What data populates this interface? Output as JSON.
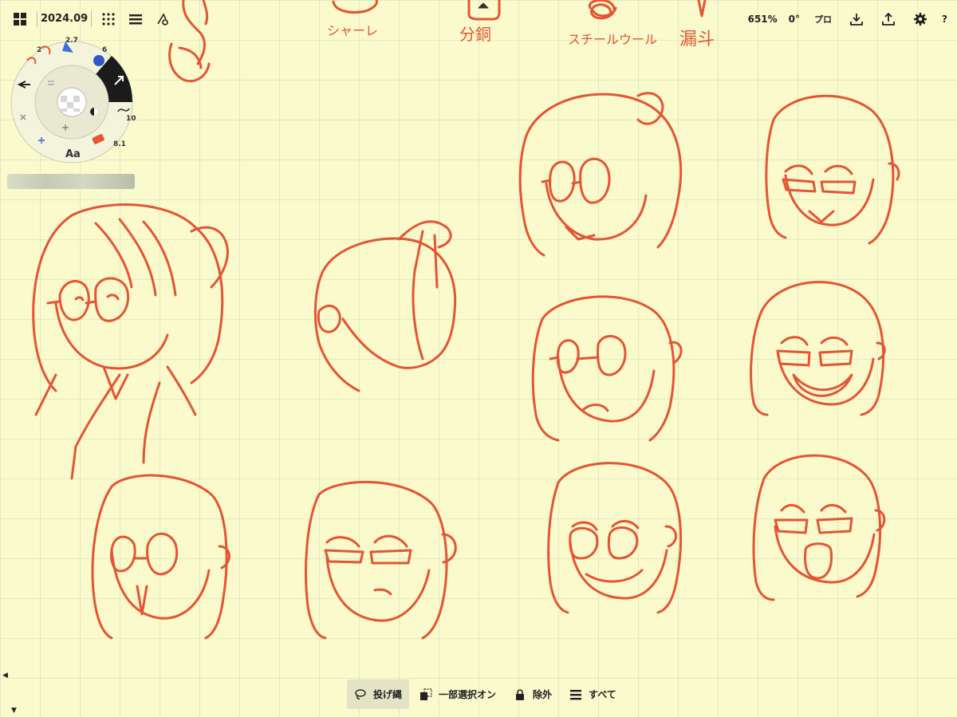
{
  "toolbar": {
    "title": "2024.09",
    "zoom": "651%",
    "rotation": "0°",
    "pro_label": "プロ",
    "help_label": "?"
  },
  "tool_wheel": {
    "pencil_size": "2",
    "airbrush_size": "2.7",
    "watercolor_size": "6",
    "brush_size": "10",
    "eraser_size": "8.1",
    "text_tool": "Aa"
  },
  "sketch_labels": [
    "シャーレ",
    "分銅",
    "スチールウール",
    "漏斗"
  ],
  "bottom_toolbar": {
    "lasso": "投げ縄",
    "partial_select": "一部選択オン",
    "exclude": "除外",
    "all": "すべて"
  },
  "colors": {
    "ink": "#e55534",
    "paper": "#fafacd",
    "grid": "#b9cdb4"
  }
}
